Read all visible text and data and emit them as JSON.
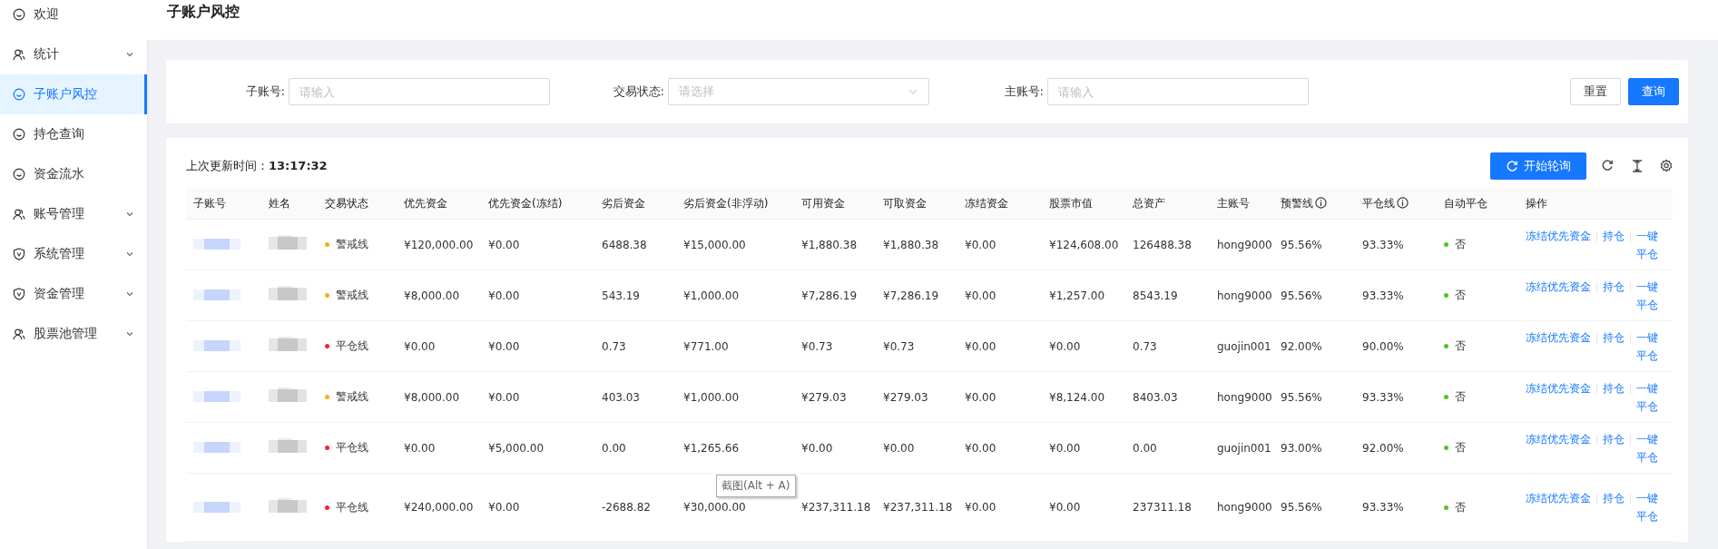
{
  "sidebar": {
    "items": [
      {
        "label": "欢迎",
        "kind": "smile",
        "expandable": false,
        "selected": false
      },
      {
        "label": "统计",
        "kind": "user",
        "expandable": true,
        "selected": false
      },
      {
        "label": "子账户风控",
        "kind": "smile",
        "expandable": false,
        "selected": true
      },
      {
        "label": "持仓查询",
        "kind": "smile",
        "expandable": false,
        "selected": false
      },
      {
        "label": "资金流水",
        "kind": "smile",
        "expandable": false,
        "selected": false
      },
      {
        "label": "账号管理",
        "kind": "user",
        "expandable": true,
        "selected": false
      },
      {
        "label": "系统管理",
        "kind": "shield",
        "expandable": true,
        "selected": false
      },
      {
        "label": "资金管理",
        "kind": "shield",
        "expandable": true,
        "selected": false
      },
      {
        "label": "股票池管理",
        "kind": "user",
        "expandable": true,
        "selected": false
      }
    ]
  },
  "page_title": "子账户风控",
  "filters": [
    {
      "label": "子账号:",
      "kind": "input",
      "placeholder": "请输入"
    },
    {
      "label": "交易状态:",
      "kind": "select",
      "placeholder": "请选择"
    },
    {
      "label": "主账号:",
      "kind": "input",
      "placeholder": "请输入"
    }
  ],
  "filter_buttons": [
    {
      "label": "重置",
      "primary": false
    },
    {
      "label": "查询",
      "primary": true
    }
  ],
  "toolbar": {
    "updated_label": "上次更新时间：",
    "updated_time": "13:17:32",
    "poll_button": "开始轮询"
  },
  "table": {
    "columns": [
      {
        "label": "子账号",
        "info": false
      },
      {
        "label": "姓名",
        "info": false
      },
      {
        "label": "交易状态",
        "info": false
      },
      {
        "label": "优先资金",
        "info": false
      },
      {
        "label": "优先资金(冻结)",
        "info": false
      },
      {
        "label": "劣后资金",
        "info": false
      },
      {
        "label": "劣后资金(非浮动)",
        "info": false
      },
      {
        "label": "可用资金",
        "info": false
      },
      {
        "label": "可取资金",
        "info": false
      },
      {
        "label": "冻结资金",
        "info": false
      },
      {
        "label": "股票市值",
        "info": false
      },
      {
        "label": "总资产",
        "info": false
      },
      {
        "label": "主账号",
        "info": false
      },
      {
        "label": "预警线",
        "info": true
      },
      {
        "label": "平仓线",
        "info": true
      },
      {
        "label": "自动平仓",
        "info": false
      },
      {
        "label": "操作",
        "info": false
      }
    ],
    "rows": [
      {
        "cells": [
          {
            "kind": "redacted"
          },
          {
            "kind": "redacted"
          },
          {
            "kind": "status",
            "text": "警戒线",
            "color": "#faad14"
          },
          "¥120,000.00",
          "¥0.00",
          "6488.38",
          "¥15,000.00",
          "¥1,880.38",
          "¥1,880.38",
          "¥0.00",
          "¥124,608.00",
          "126488.38",
          "hong9000",
          "95.56%",
          "93.33%",
          {
            "kind": "status",
            "text": "否",
            "color": "#52c41a"
          },
          {
            "kind": "actions",
            "actions": [
              "冻结优先资金",
              "持仓",
              "一键平仓"
            ]
          }
        ]
      },
      {
        "cells": [
          {
            "kind": "redacted"
          },
          {
            "kind": "redacted"
          },
          {
            "kind": "status",
            "text": "警戒线",
            "color": "#faad14"
          },
          "¥8,000.00",
          "¥0.00",
          "543.19",
          "¥1,000.00",
          "¥7,286.19",
          "¥7,286.19",
          "¥0.00",
          "¥1,257.00",
          "8543.19",
          "hong9000",
          "95.56%",
          "93.33%",
          {
            "kind": "status",
            "text": "否",
            "color": "#52c41a"
          },
          {
            "kind": "actions",
            "actions": [
              "冻结优先资金",
              "持仓",
              "一键平仓"
            ]
          }
        ]
      },
      {
        "cells": [
          {
            "kind": "redacted"
          },
          {
            "kind": "redacted"
          },
          {
            "kind": "status",
            "text": "平仓线",
            "color": "#f5222d"
          },
          "¥0.00",
          "¥0.00",
          "0.73",
          "¥771.00",
          "¥0.73",
          "¥0.73",
          "¥0.00",
          "¥0.00",
          "0.73",
          "guojin001",
          "92.00%",
          "90.00%",
          {
            "kind": "status",
            "text": "否",
            "color": "#52c41a"
          },
          {
            "kind": "actions",
            "actions": [
              "冻结优先资金",
              "持仓",
              "一键平仓"
            ]
          }
        ]
      },
      {
        "cells": [
          {
            "kind": "redacted"
          },
          {
            "kind": "redacted"
          },
          {
            "kind": "status",
            "text": "警戒线",
            "color": "#faad14"
          },
          "¥8,000.00",
          "¥0.00",
          "403.03",
          "¥1,000.00",
          "¥279.03",
          "¥279.03",
          "¥0.00",
          "¥8,124.00",
          "8403.03",
          "hong9000",
          "95.56%",
          "93.33%",
          {
            "kind": "status",
            "text": "否",
            "color": "#52c41a"
          },
          {
            "kind": "actions",
            "actions": [
              "冻结优先资金",
              "持仓",
              "一键平仓"
            ]
          }
        ]
      },
      {
        "cells": [
          {
            "kind": "redacted"
          },
          {
            "kind": "redacted"
          },
          {
            "kind": "status",
            "text": "平仓线",
            "color": "#f5222d"
          },
          "¥0.00",
          "¥5,000.00",
          "0.00",
          "¥1,265.66",
          "¥0.00",
          "¥0.00",
          "¥0.00",
          "¥0.00",
          "0.00",
          "guojin001",
          "93.00%",
          "92.00%",
          {
            "kind": "status",
            "text": "否",
            "color": "#52c41a"
          },
          {
            "kind": "actions",
            "actions": [
              "冻结优先资金",
              "持仓",
              "一键平仓"
            ]
          }
        ]
      },
      {
        "cells": [
          {
            "kind": "redacted"
          },
          {
            "kind": "redacted"
          },
          {
            "kind": "status",
            "text": "平仓线",
            "color": "#f5222d"
          },
          "¥240,000.00",
          "¥0.00",
          "-2688.82",
          "¥30,000.00",
          "¥237,311.18",
          "¥237,311.18",
          "¥0.00",
          "¥0.00",
          "237311.18",
          "hong9000",
          "95.56%",
          "93.33%",
          {
            "kind": "status",
            "text": "否",
            "color": "#52c41a"
          },
          {
            "kind": "actions",
            "actions": [
              "冻结优先资金",
              "持仓",
              "一键平仓"
            ]
          }
        ]
      }
    ]
  },
  "tooltip": "截图(Alt + A)"
}
